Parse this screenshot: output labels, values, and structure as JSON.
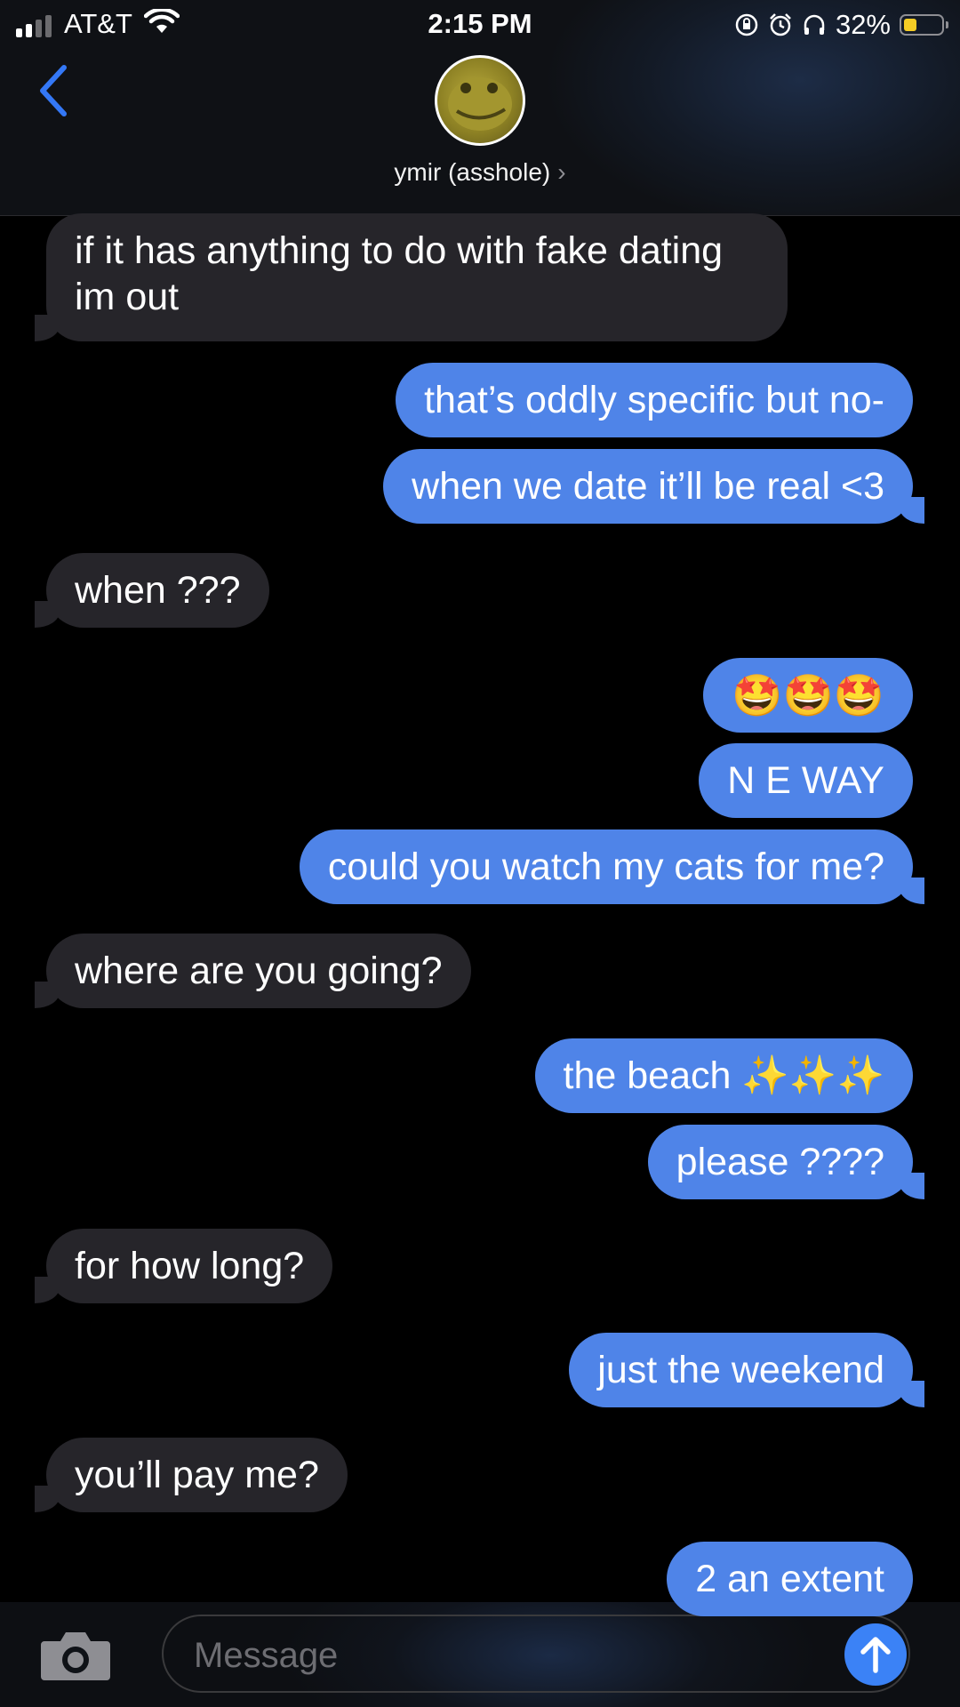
{
  "status_bar": {
    "carrier": "AT&T",
    "time": "2:15 PM",
    "battery": "32%",
    "battery_level": 0.32
  },
  "header": {
    "contact_name": "ymir (asshole)",
    "back_icon": "chevron-left-icon",
    "avatar": "contact-avatar"
  },
  "messages": [
    {
      "side": "received",
      "text_line1": "if it has anything to do with fake dating",
      "text_line2": "im out"
    },
    {
      "side": "sent",
      "text": "that’s oddly specific but no-"
    },
    {
      "side": "sent",
      "text": "when we date it’ll be real <3"
    },
    {
      "side": "received",
      "text": "when ???"
    },
    {
      "side": "sent",
      "text": "🤩🤩🤩"
    },
    {
      "side": "sent",
      "text": "N E WAY"
    },
    {
      "side": "sent",
      "text": "could you watch my cats for me?"
    },
    {
      "side": "received",
      "text": "where are you going?"
    },
    {
      "side": "sent",
      "text": "the beach ✨✨✨"
    },
    {
      "side": "sent",
      "text": "please ????"
    },
    {
      "side": "received",
      "text": "for how long?"
    },
    {
      "side": "sent",
      "text": "just the weekend"
    },
    {
      "side": "received",
      "text": "you’ll pay me?"
    },
    {
      "side": "sent",
      "text": "2 an extent"
    }
  ],
  "input": {
    "placeholder": "Message",
    "camera_icon": "camera-icon",
    "send_icon": "send-arrow-icon"
  },
  "colors": {
    "sent_bubble": "#4f84e8",
    "received_bubble": "#26252a",
    "background": "#000000"
  }
}
